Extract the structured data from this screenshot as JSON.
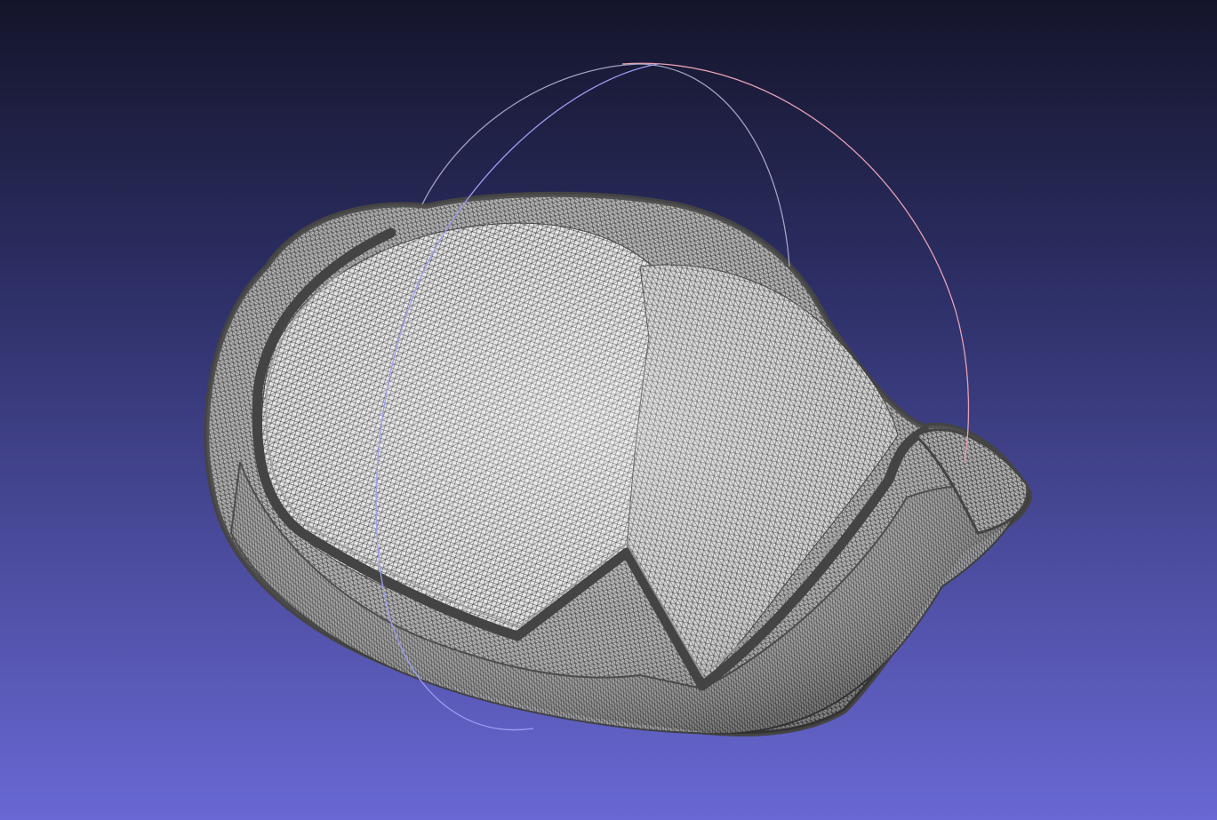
{
  "viewport": {
    "background": {
      "top_color": "#14152a",
      "bottom_color": "#6968d4"
    },
    "render_mode": "wireframe",
    "mesh": {
      "wire_color": "#3c3c3c",
      "surface_light": "#e8e8e8",
      "surface_shade": "#8a8a8a"
    },
    "trackball": {
      "visible": true,
      "ring_colors": {
        "x": "#e7a0b4",
        "y": "#9d9df2",
        "z": "#a8d8a8"
      }
    }
  }
}
